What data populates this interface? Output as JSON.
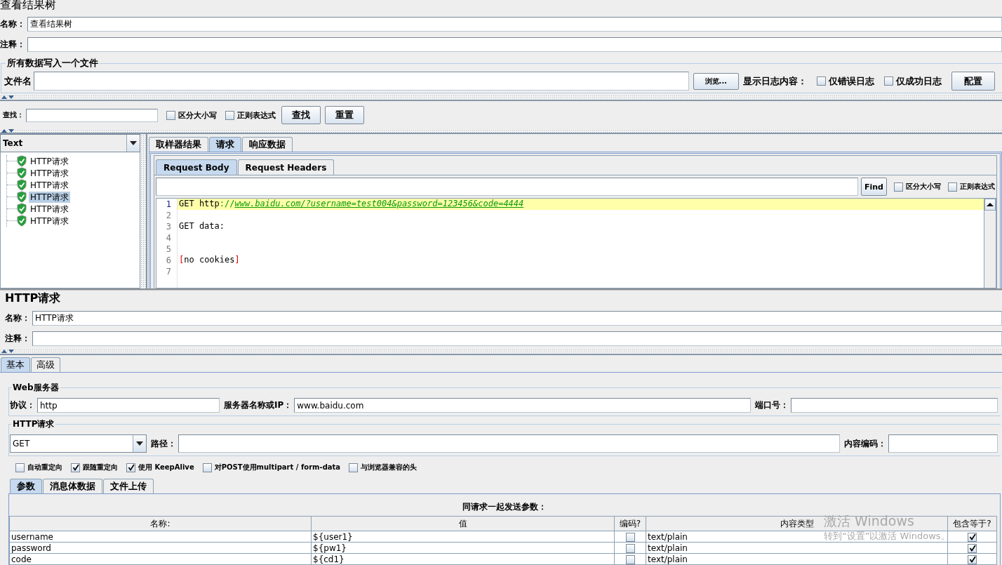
{
  "results_tree": {
    "title": "查看结果树",
    "name": {
      "label": "名称：",
      "value": "查看结果树"
    },
    "comment": {
      "label": "注释："
    },
    "file_group": {
      "legend": "所有数据写入一个文件",
      "file_label": "文件名",
      "browse_button": "浏览...",
      "log_label": "显示日志内容：",
      "log_options": [
        {
          "label": "仅错误日志",
          "checked": false
        },
        {
          "label": "仅成功日志",
          "checked": false
        }
      ],
      "config_button": "配置"
    },
    "search": {
      "label": "查找：",
      "options": [
        {
          "label": "区分大小写",
          "checked": false
        },
        {
          "label": "正则表达式",
          "checked": false
        }
      ],
      "buttons": [
        "查找",
        "重置"
      ]
    },
    "renderer": {
      "value": "Text"
    },
    "tree": [
      {
        "label": "HTTP请求",
        "selected": false
      },
      {
        "label": "HTTP请求",
        "selected": false
      },
      {
        "label": "HTTP请求",
        "selected": false
      },
      {
        "label": "HTTP请求",
        "selected": true
      },
      {
        "label": "HTTP请求",
        "selected": false
      },
      {
        "label": "HTTP请求",
        "selected": false
      }
    ],
    "tabs": [
      {
        "label": "取样器结果",
        "selected": false
      },
      {
        "label": "请求",
        "selected": true
      },
      {
        "label": "响应数据",
        "selected": false
      }
    ],
    "request_tabs": [
      {
        "label": "Request Body",
        "selected": true
      },
      {
        "label": "Request Headers",
        "selected": false
      }
    ],
    "find_bar": {
      "button": "Find",
      "options": [
        {
          "label": "区分大小写",
          "checked": false
        },
        {
          "label": "正则表达式",
          "checked": false
        }
      ]
    },
    "code_lines": [
      {
        "number": "1",
        "current": true,
        "parts": [
          {
            "text": "GET http",
            "kind": "plain"
          },
          {
            "text": "://",
            "kind": "symbol"
          },
          {
            "text": "www.baidu.com/?username=test004&password=123456&code=4444",
            "kind": "link"
          }
        ]
      },
      {
        "number": "2",
        "current": false
      },
      {
        "number": "3",
        "current": false,
        "parts": [
          {
            "text": "GET data:",
            "kind": "plain"
          }
        ]
      },
      {
        "number": "4",
        "current": false
      },
      {
        "number": "5",
        "current": false
      },
      {
        "number": "6",
        "current": false,
        "parts": [
          {
            "text": "[",
            "kind": "bracket"
          },
          {
            "text": "no cookies",
            "kind": "plain"
          },
          {
            "text": "]",
            "kind": "bracket"
          }
        ]
      },
      {
        "number": "7",
        "current": false
      }
    ]
  },
  "sampler": {
    "title": "HTTP请求",
    "name": {
      "label": "名称：",
      "value": "HTTP请求"
    },
    "comment": {
      "label": "注释："
    },
    "tabs": [
      {
        "label": "基本",
        "selected": true
      },
      {
        "label": "高级",
        "selected": false
      }
    ],
    "web_server": {
      "legend": "Web服务器",
      "protocol": {
        "label": "协议：",
        "value": "http"
      },
      "server": {
        "label": "服务器名称或IP：",
        "value": "www.baidu.com"
      },
      "port": {
        "label": "端口号："
      }
    },
    "http_request": {
      "legend": "HTTP请求",
      "method": "GET",
      "path": {
        "label": "路径："
      },
      "encoding": {
        "label": "内容编码："
      },
      "options": [
        {
          "label": "自动重定向",
          "checked": false
        },
        {
          "label": "跟随重定向",
          "checked": true
        },
        {
          "label": "使用 KeepAlive",
          "checked": true
        },
        {
          "label": "对POST使用multipart / form-data",
          "checked": false
        },
        {
          "label": "与浏览器兼容的头",
          "checked": false
        }
      ]
    },
    "param_tabs": [
      {
        "label": "参数",
        "selected": true
      },
      {
        "label": "消息体数据",
        "selected": false
      },
      {
        "label": "文件上传",
        "selected": false
      }
    ],
    "params": {
      "caption": "同请求一起发送参数：",
      "columns": [
        "名称:",
        "值",
        "编码?",
        "内容类型",
        "包含等于?"
      ],
      "rows": [
        {
          "name": "username",
          "value": "${user1}",
          "encode": false,
          "content_type": "text/plain",
          "include_equals": true
        },
        {
          "name": "password",
          "value": "${pw1}",
          "encode": false,
          "content_type": "text/plain",
          "include_equals": true
        },
        {
          "name": "code",
          "value": "${cd1}",
          "encode": false,
          "content_type": "text/plain",
          "include_equals": true
        }
      ]
    }
  },
  "os_notice": {
    "title": "激活 Windows",
    "hint": "转到“设置”以激活 Windows。"
  }
}
